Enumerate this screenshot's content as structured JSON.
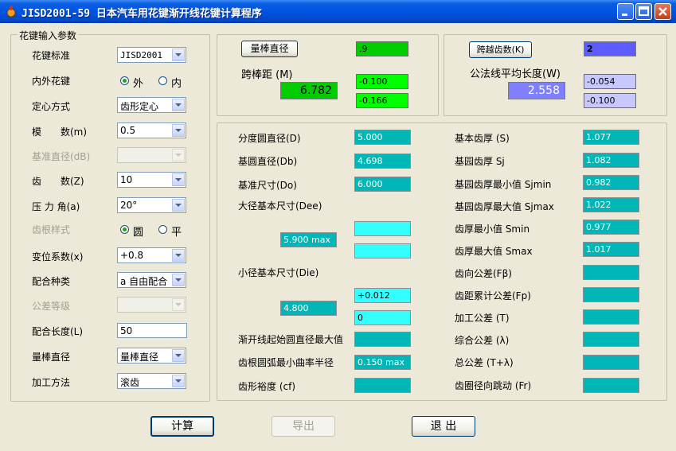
{
  "window": {
    "title": "JISD2001-59 日本汽车用花键渐开线花键计算程序",
    "icon": "app-logo-icon"
  },
  "input_group": {
    "legend": "花键输入参数",
    "rows": [
      {
        "label": "花键标准",
        "value": "JISD2001",
        "enabled": true
      },
      {
        "label": "内外花键",
        "radio": [
          "外",
          "内"
        ],
        "selected": 0,
        "enabled": true
      },
      {
        "label": "定心方式",
        "value": "齿形定心",
        "enabled": true
      },
      {
        "label": "模　　数(m)",
        "value": "0.5",
        "enabled": true
      },
      {
        "label": "基准直径(dB)",
        "value": "",
        "enabled": false
      },
      {
        "label": "齿　　数(Z)",
        "value": "10",
        "enabled": true
      },
      {
        "label": "压 力 角(a)",
        "value": "20°",
        "enabled": true
      },
      {
        "label": "齿根样式",
        "radio": [
          "圆",
          "平"
        ],
        "selected": 0,
        "enabled": false
      },
      {
        "label": "变位系数(x)",
        "value": "+0.8",
        "enabled": true
      },
      {
        "label": "配合种类",
        "value": "a 自由配合",
        "enabled": true
      },
      {
        "label": "公差等级",
        "value": "",
        "enabled": false
      },
      {
        "label": "配合长度(L)",
        "value": "50",
        "textbox": true,
        "enabled": true
      },
      {
        "label": "量棒直径",
        "value": "量棒直径",
        "enabled": true
      },
      {
        "label": "加工方法",
        "value": "滚齿",
        "enabled": true
      }
    ]
  },
  "pin_group": {
    "button": "量棒直径",
    "pin_diameter": ".9",
    "label": "跨棒距 (M)",
    "value": "6.782",
    "upper_dev": "-0.100",
    "lower_dev": "-0.166"
  },
  "span_group": {
    "button": "跨越齿数(K)",
    "teeth": "2",
    "label": "公法线平均长度(W)",
    "value": "2.558",
    "upper_dev": "-0.054",
    "lower_dev": "-0.100"
  },
  "results": {
    "left": [
      {
        "label": "分度圆直径(D)",
        "value": "5.000"
      },
      {
        "label": "基圆直径(Db)",
        "value": "4.698"
      },
      {
        "label": "基准尺寸(Do)",
        "value": "6.000"
      },
      {
        "label": "大径基本尺寸(Dee)"
      },
      {
        "label": "小径基本尺寸(Die)"
      },
      {
        "label": "渐开线起始圆直径最大值",
        "value": ""
      },
      {
        "label": "齿根圆弧最小曲率半径",
        "value": "0.150 max"
      },
      {
        "label": "齿形裕度 (cf)",
        "value": ""
      }
    ],
    "dee_value": "5.900 max",
    "dee_upper": "",
    "dee_lower": "",
    "die_value": "4.800",
    "die_upper": "+0.012",
    "die_lower": "0",
    "right": [
      {
        "label": "基本齿厚 (S)",
        "value": "1.077"
      },
      {
        "label": "基园齿厚 Sj",
        "value": "1.082"
      },
      {
        "label": "基园齿厚最小值 Sjmin",
        "value": "0.982"
      },
      {
        "label": "基园齿厚最大值 Sjmax",
        "value": "1.022"
      },
      {
        "label": "齿厚最小值 Smin",
        "value": "0.977"
      },
      {
        "label": "齿厚最大值 Smax",
        "value": "1.017"
      },
      {
        "label": "齿向公差(Fβ)",
        "value": ""
      },
      {
        "label": "齿距累计公差(Fp)",
        "value": ""
      },
      {
        "label": "加工公差 (T)",
        "value": ""
      },
      {
        "label": "综合公差 (λ)",
        "value": ""
      },
      {
        "label": "总公差 (T+λ)",
        "value": ""
      },
      {
        "label": "齿圈径向跳动 (Fr)",
        "value": ""
      }
    ]
  },
  "buttons": {
    "calculate": "计算",
    "export": "导出",
    "exit": "退 出"
  },
  "colors": {
    "title_bar": "#0054e3",
    "result_box": "#00b6b6",
    "tolerance_box": "#33ffff",
    "pin_box": "#00cc00",
    "dev_box": "#00ff00",
    "span_box": "#7f7fff",
    "span_dev_box": "#c8c8ff"
  }
}
